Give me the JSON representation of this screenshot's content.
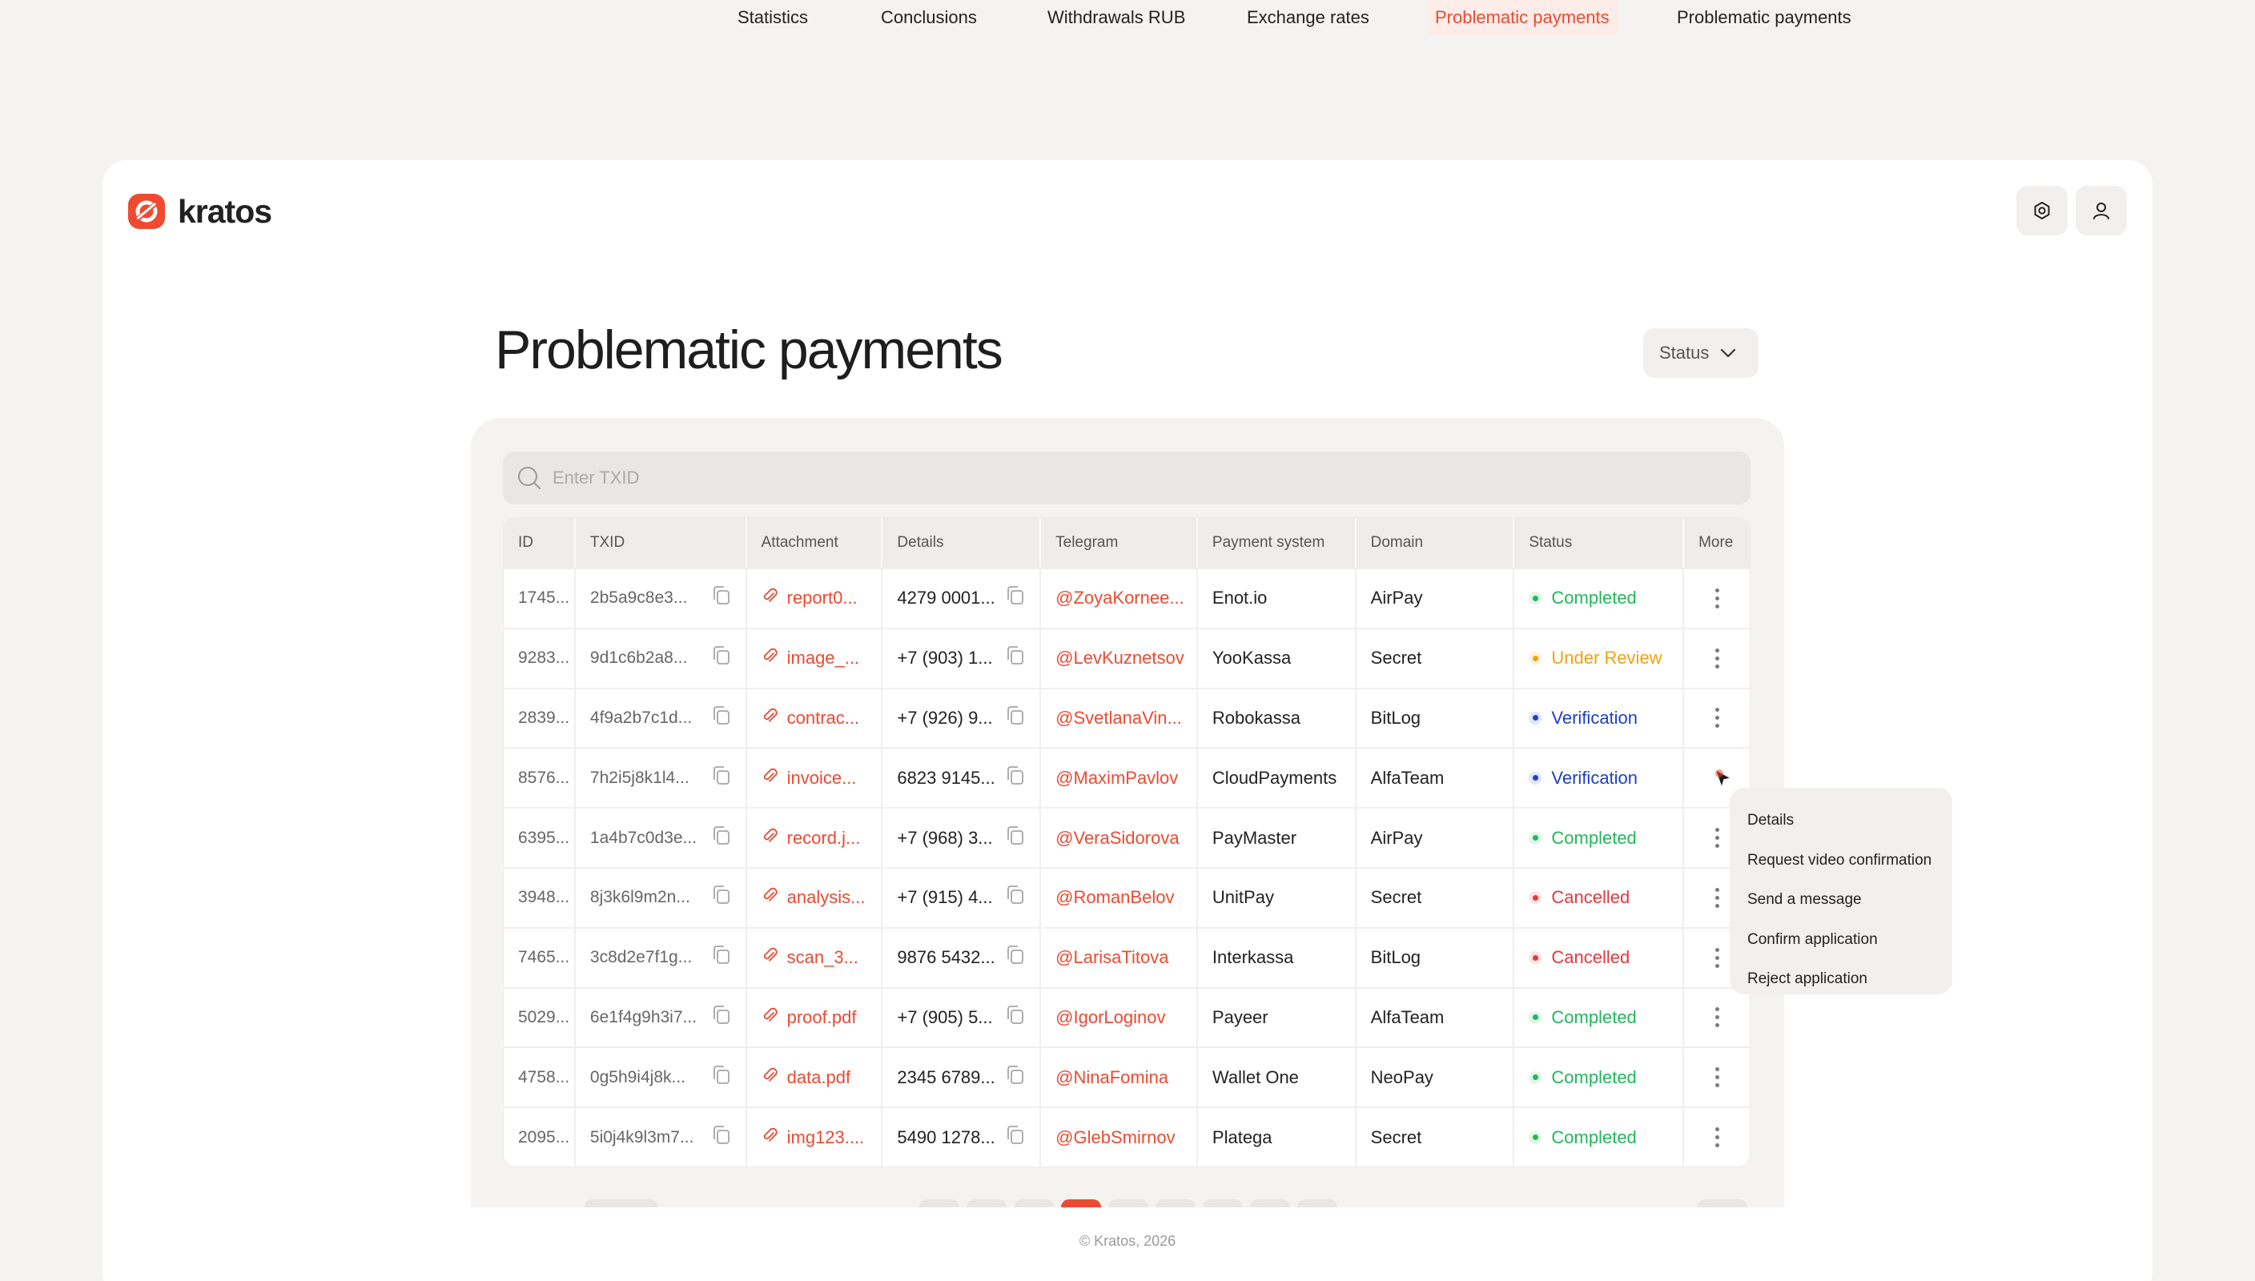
{
  "app": {
    "name": "kratos",
    "accent": "#ec4a32"
  },
  "nav": {
    "items": [
      {
        "label": "Statistics",
        "active": false
      },
      {
        "label": "Conclusions",
        "active": false
      },
      {
        "label": "Withdrawals RUB",
        "active": false
      },
      {
        "label": "Exchange rates",
        "active": false
      },
      {
        "label": "Problematic payments",
        "active": true
      },
      {
        "label": "Problematic payments",
        "active": false
      }
    ],
    "icons": [
      "settings-icon",
      "user-icon"
    ]
  },
  "page": {
    "title": "Problematic payments",
    "status_filter": "Status",
    "search_placeholder": "Enter TXID"
  },
  "table": {
    "columns": [
      "ID",
      "TXID",
      "Attachment",
      "Details",
      "Telegram",
      "Payment system",
      "Domain",
      "Status",
      "More"
    ],
    "rows": [
      {
        "id": "1745...",
        "txid": "2b5a9c8e3...",
        "attachment": "report0...",
        "details": "4279 0001...",
        "telegram": "@ZoyaKornee...",
        "payment_system": "Enot.io",
        "domain": "AirPay",
        "status": "Completed",
        "status_kind": "completed"
      },
      {
        "id": "9283...",
        "txid": "9d1c6b2a8...",
        "attachment": "image_...",
        "details": "+7 (903) 1...",
        "telegram": "@LevKuznetsov",
        "payment_system": "YooKassa",
        "domain": "Secret",
        "status": "Under Review",
        "status_kind": "review"
      },
      {
        "id": "2839...",
        "txid": "4f9a2b7c1d...",
        "attachment": "contrac...",
        "details": "+7 (926) 9...",
        "telegram": "@SvetlanaVin...",
        "payment_system": "Robokassa",
        "domain": "BitLog",
        "status": "Verification",
        "status_kind": "verification"
      },
      {
        "id": "8576...",
        "txid": "7h2i5j8k1l4...",
        "attachment": "invoice...",
        "details": "6823 9145...",
        "telegram": "@MaximPavlov",
        "payment_system": "CloudPayments",
        "domain": "AlfaTeam",
        "status": "Verification",
        "status_kind": "verification"
      },
      {
        "id": "6395...",
        "txid": "1a4b7c0d3e...",
        "attachment": "record.j...",
        "details": "+7 (968) 3...",
        "telegram": "@VeraSidorova",
        "payment_system": "PayMaster",
        "domain": "AirPay",
        "status": "Completed",
        "status_kind": "completed"
      },
      {
        "id": "3948...",
        "txid": "8j3k6l9m2n...",
        "attachment": "analysis...",
        "details": "+7 (915) 4...",
        "telegram": "@RomanBelov",
        "payment_system": "UnitPay",
        "domain": "Secret",
        "status": "Cancelled",
        "status_kind": "cancelled"
      },
      {
        "id": "7465...",
        "txid": "3c8d2e7f1g...",
        "attachment": "scan_3...",
        "details": "9876 5432...",
        "telegram": "@LarisaTitova",
        "payment_system": "Interkassa",
        "domain": "BitLog",
        "status": "Cancelled",
        "status_kind": "cancelled"
      },
      {
        "id": "5029...",
        "txid": "6e1f4g9h3i7...",
        "attachment": "proof.pdf",
        "details": "+7 (905) 5...",
        "telegram": "@IgorLoginov",
        "payment_system": "Payeer",
        "domain": "AlfaTeam",
        "status": "Completed",
        "status_kind": "completed"
      },
      {
        "id": "4758...",
        "txid": "0g5h9i4j8k...",
        "attachment": "data.pdf",
        "details": "2345 6789...",
        "telegram": "@NinaFomina",
        "payment_system": "Wallet One",
        "domain": "NeoPay",
        "status": "Completed",
        "status_kind": "completed"
      },
      {
        "id": "2095...",
        "txid": "5i0j4k9l3m7...",
        "attachment": "img123....",
        "details": "5490 1278...",
        "telegram": "@GlebSmirnov",
        "payment_system": "Platega",
        "domain": "Secret",
        "status": "Completed",
        "status_kind": "completed"
      }
    ]
  },
  "status_colors": {
    "completed": "#1fb85a",
    "review": "#f5a00f",
    "verification": "#1e3fc4",
    "cancelled": "#e5383b"
  },
  "context_menu": {
    "items": [
      "Details",
      "Request video confirmation",
      "Send a message",
      "Confirm application",
      "Reject application"
    ]
  },
  "footer": "© Kratos, 2026"
}
